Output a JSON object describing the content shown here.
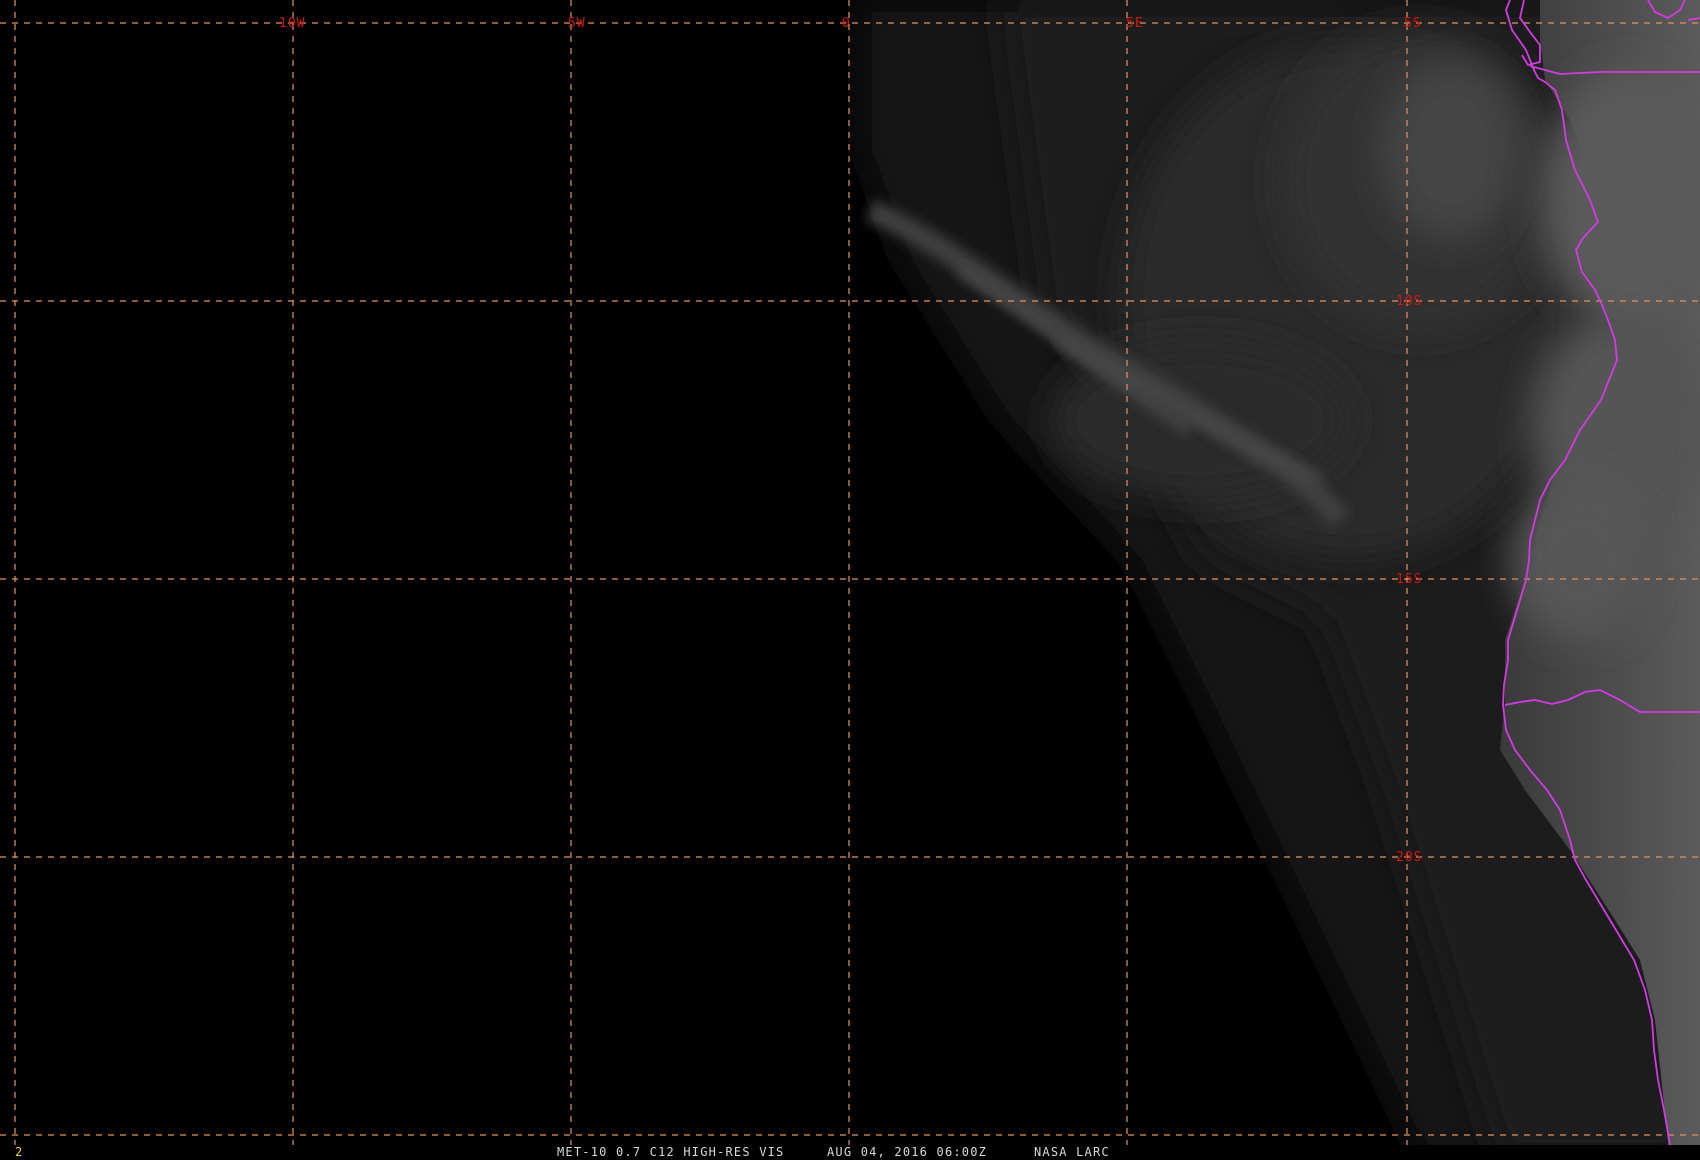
{
  "image": {
    "background": "#000000",
    "grid_color": "#e3955f",
    "label_color": "#d01616",
    "border_color": "#d23be3",
    "caption_color": "#d8d8d8",
    "frame_number_color": "#e8d23a"
  },
  "grid": {
    "longitude_labels": [
      "10W",
      "5W",
      "0",
      "5E",
      "5S"
    ],
    "latitude_labels": [
      "10S",
      "15S",
      "20S"
    ]
  },
  "caption": {
    "frame_number": "2",
    "product": "MET-10 0.7 C12 HIGH-RES VIS",
    "datetime": "AUG 04, 2016 06:00Z",
    "credit": "NASA LARC"
  },
  "layers": {
    "imagery": "visible-satellite-cloud-imagery",
    "overlay": "political-border-overlay",
    "graticule": "lat-lon-graticule"
  }
}
